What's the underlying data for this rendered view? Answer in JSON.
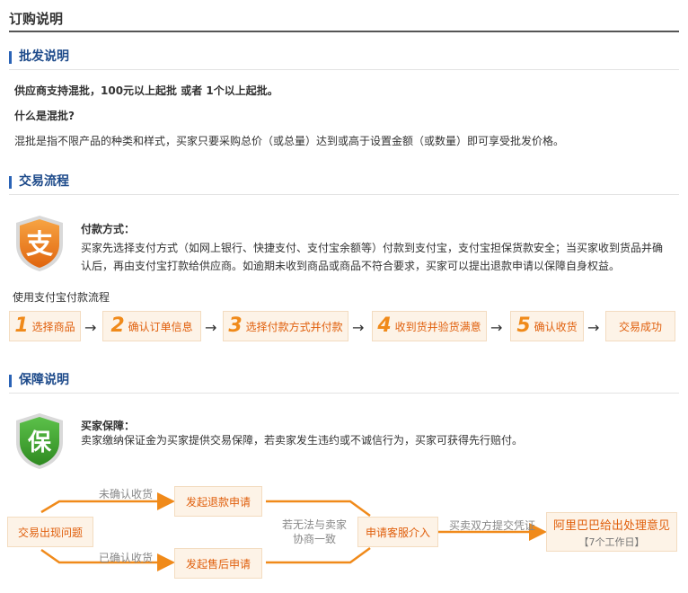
{
  "page_title": "订购说明",
  "wholesale": {
    "heading": "批发说明",
    "support_line": "供应商支持混批，100元以上起批 或者 1个以上起批。",
    "question": "什么是混批?",
    "explanation": "混批是指不限产品的种类和样式，买家只要采购总价（或总量）达到或高于设置金额（或数量）即可享受批发价格。"
  },
  "transaction": {
    "heading": "交易流程",
    "icon_glyph": "支",
    "payment_title": "付款方式：",
    "payment_desc": "买家先选择支付方式（如网上银行、快捷支付、支付宝余额等）付款到支付宝，支付宝担保货款安全；当买家收到货品并确认后，再由支付宝打款给供应商。如逾期未收到商品或商品不符合要求，买家可以提出退款申请以保障自身权益。",
    "flow_caption": "使用支付宝付款流程",
    "arrow_glyph": "→",
    "steps": [
      {
        "num": "1",
        "label": "选择商品"
      },
      {
        "num": "2",
        "label": "确认订单信息"
      },
      {
        "num": "3",
        "label": "选择付款方式并付款"
      },
      {
        "num": "4",
        "label": "收到货并验货满意"
      },
      {
        "num": "5",
        "label": "确认收货"
      },
      {
        "num": "",
        "label": "交易成功"
      }
    ]
  },
  "guarantee": {
    "heading": "保障说明",
    "icon_glyph": "保",
    "title": "买家保障：",
    "desc": "卖家缴纳保证金为买家提供交易保障，若卖家发生违约或不诚信行为，买家可获得先行赔付。",
    "dispute": {
      "start": "交易出现问题",
      "label_unconfirmed": "未确认收货",
      "label_confirmed": "已确认收货",
      "refund": "发起退款申请",
      "after_sales": "发起售后申请",
      "negotiate_line1": "若无法与卖家",
      "negotiate_line2": "协商一致",
      "service": "申请客服介入",
      "evidence_label": "买卖双方提交凭证",
      "final_main": "阿里巴巴给出处理意见",
      "final_sub": "【7个工作日】"
    }
  },
  "colors": {
    "accent_orange": "#e05f0c",
    "heading_blue": "#1d4a8a",
    "box_fill": "#fdf3e7"
  }
}
